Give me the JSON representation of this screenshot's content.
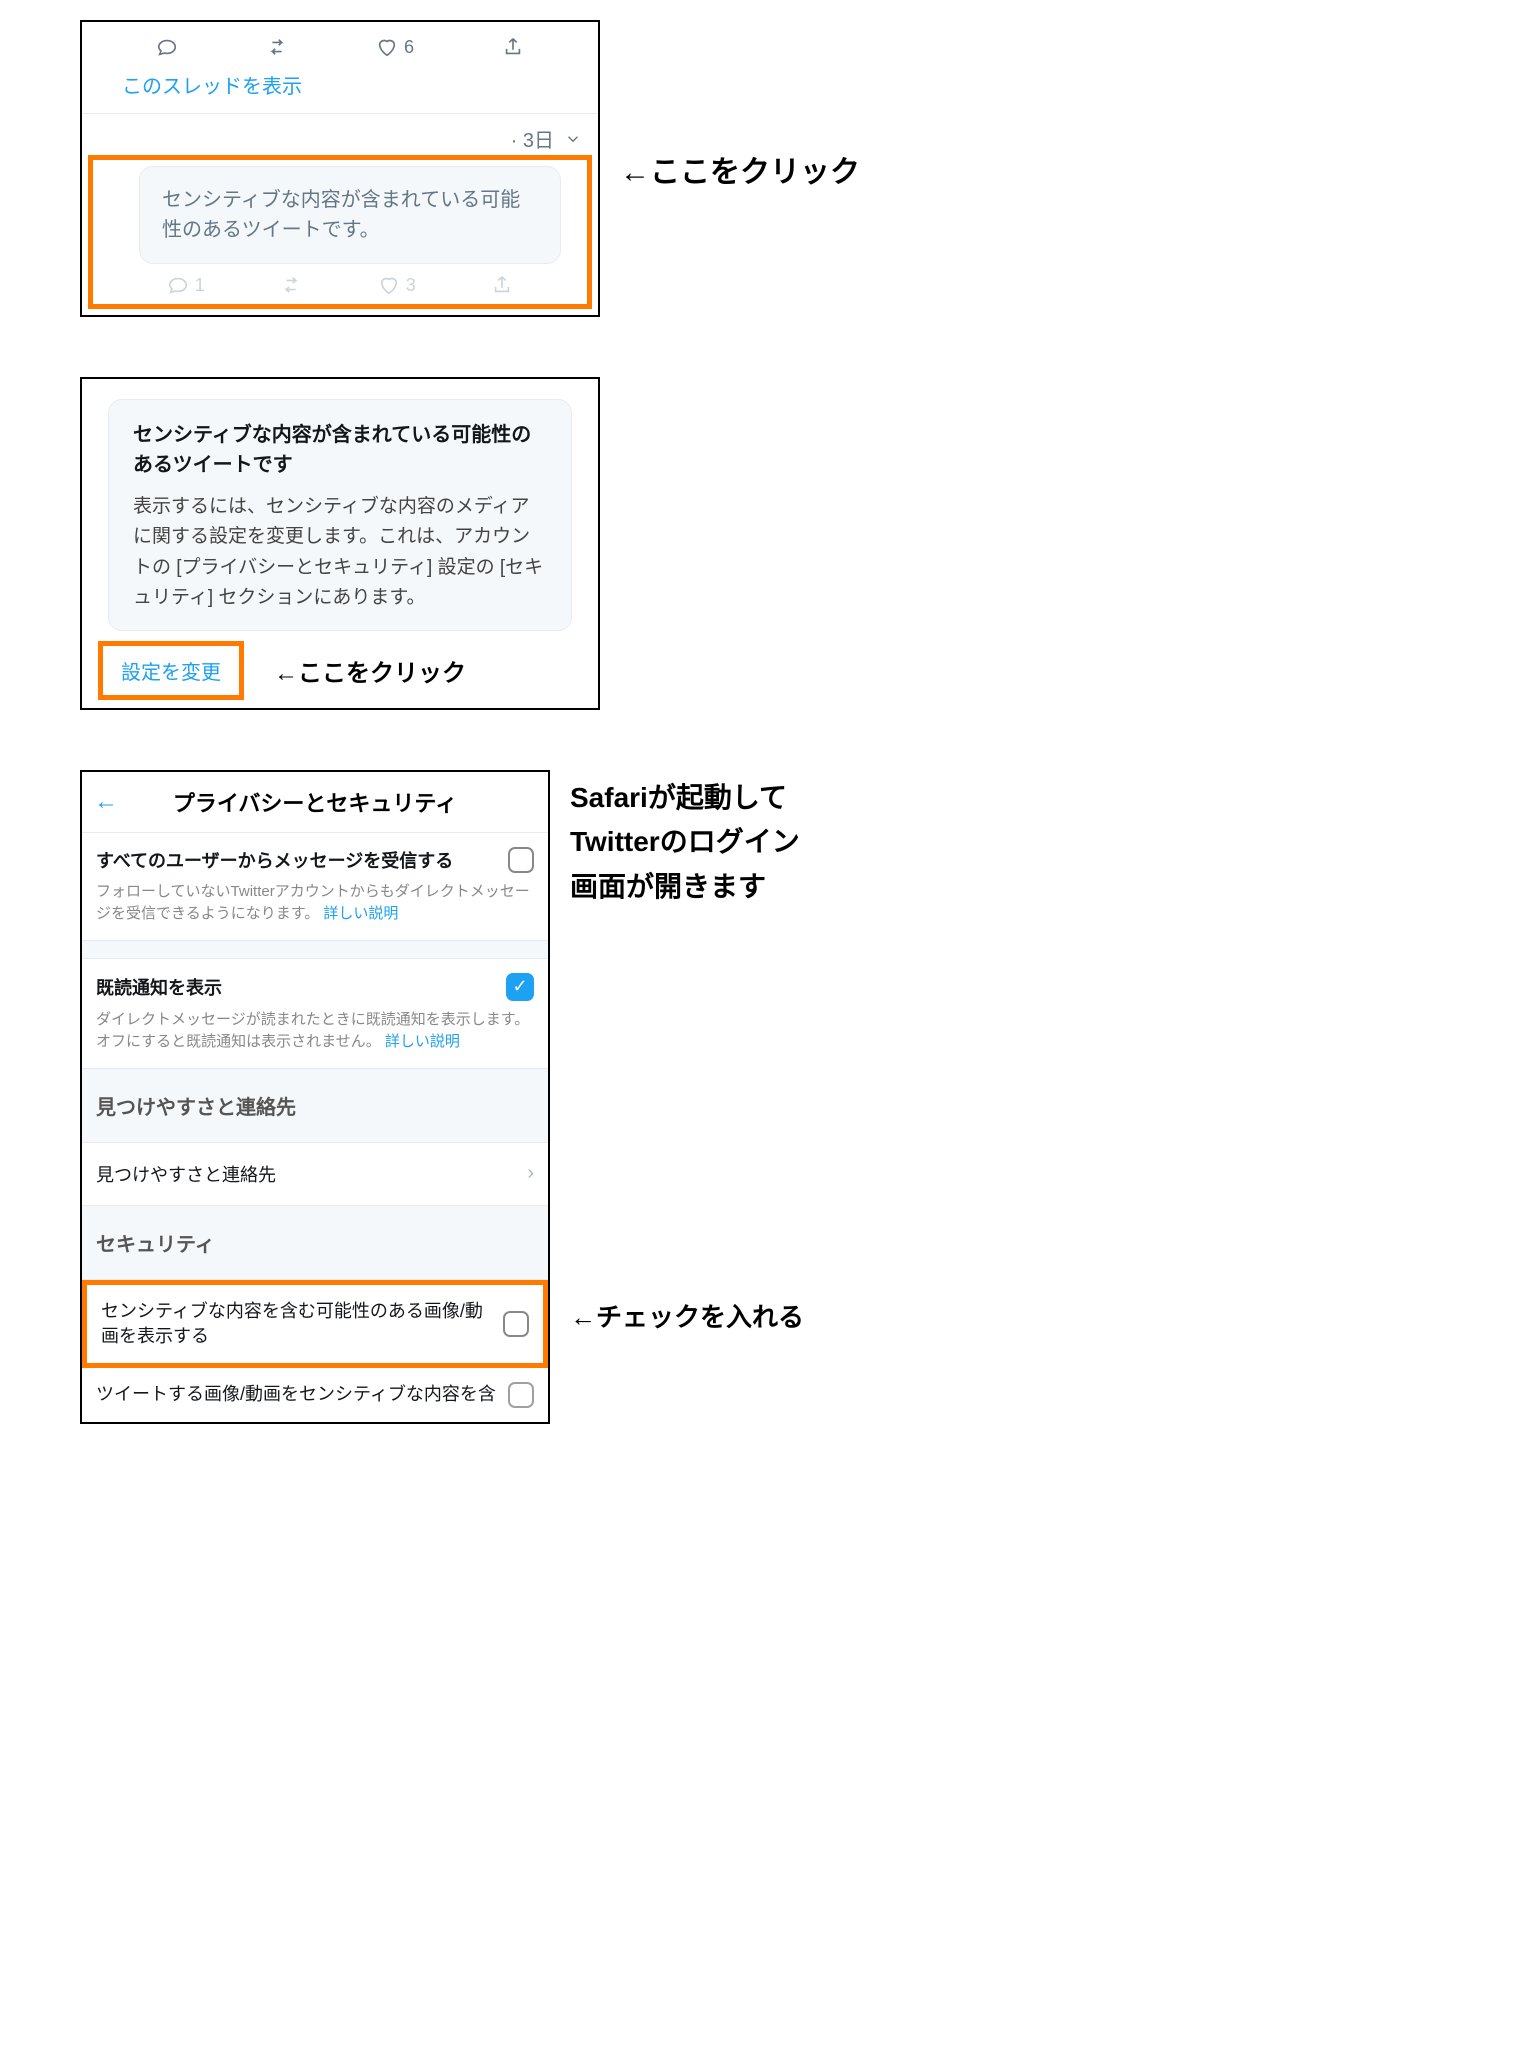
{
  "panel1": {
    "like_count": "6",
    "thread_link": "このスレッドを表示",
    "timestamp": "· 3日",
    "sensitive_msg": "センシティブな内容が含まれている可能性のあるツイートです。",
    "faded_reply": "1",
    "faded_like": "3"
  },
  "note1": "←ここをクリック",
  "panel2": {
    "title": "センシティブな内容が含まれている可能性のあるツイートです",
    "body": "表示するには、センシティブな内容のメディアに関する設定を変更します。これは、アカウントの [プライバシーとセキュリティ] 設定の [セキュリティ] セクションにあります。",
    "change": "設定を変更"
  },
  "note2": "←ここをクリック",
  "panel3": {
    "header": "プライバシーとセキュリティ",
    "row1_title": "すべてのユーザーからメッセージを受信する",
    "row1_desc": "フォローしていないTwitterアカウントからもダイレクトメッセージを受信できるようになります。",
    "row2_title": "既読通知を表示",
    "row2_desc": "ダイレクトメッセージが読まれたときに既読通知を表示します。オフにすると既読通知は表示されません。",
    "learn_more": "詳しい説明",
    "section1": "見つけやすさと連絡先",
    "nav1": "見つけやすさと連絡先",
    "section2": "セキュリティ",
    "row3_title": "センシティブな内容を含む可能性のある画像/動画を表示する",
    "row4_title": "ツイートする画像/動画をセンシティブな内容を含"
  },
  "caption3": "Safariが起動して\nTwitterのログイン\n画面が開きます",
  "note3": "←チェックを入れる"
}
